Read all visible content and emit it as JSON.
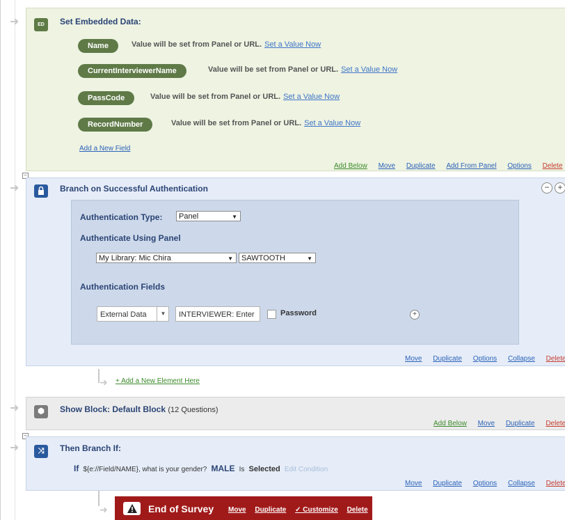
{
  "embedded": {
    "icon_label": "ED",
    "title": "Set Embedded Data:",
    "fields": [
      {
        "name": "Name",
        "info": "Value will be set from Panel or URL.",
        "link": "Set a Value Now"
      },
      {
        "name": "CurrentInterviewerName",
        "info": "Value will be set from Panel or URL.",
        "link": "Set a Value Now"
      },
      {
        "name": "PassCode",
        "info": "Value will be set from Panel or URL.",
        "link": "Set a Value Now"
      },
      {
        "name": "RecordNumber",
        "info": "Value will be set from Panel or URL.",
        "link": "Set a Value Now"
      }
    ],
    "add_field": "Add a New Field",
    "actions": {
      "add_below": "Add Below",
      "move": "Move",
      "duplicate": "Duplicate",
      "add_from_panel": "Add From Panel",
      "options": "Options",
      "delete": "Delete"
    }
  },
  "auth": {
    "title": "Branch on Successful Authentication",
    "type_label": "Authentication Type:",
    "type_value": "Panel",
    "using_label": "Authenticate Using Panel",
    "library_value": "My Library: Mic Chira",
    "panel_value": "SAWTOOTH",
    "fields_label": "Authentication Fields",
    "field_source": "External Data",
    "field_value": "INTERVIEWER: Enter",
    "password_label": "Password",
    "collapse_minus": "−",
    "collapse_plus": "+",
    "add_plus": "+",
    "actions": {
      "move": "Move",
      "duplicate": "Duplicate",
      "options": "Options",
      "collapse": "Collapse",
      "delete": "Delete"
    }
  },
  "add_element": "+ Add a New Element Here",
  "block": {
    "title": "Show Block: Default Block",
    "count": "(12 Questions)",
    "actions": {
      "add_below": "Add Below",
      "move": "Move",
      "duplicate": "Duplicate",
      "delete": "Delete"
    }
  },
  "branch": {
    "title": "Then Branch If:",
    "if": "If",
    "question": "${e://Field/NAME}, what is your gender?",
    "answer": "MALE",
    "is": "Is",
    "selected": "Selected",
    "edit": "Edit Condition",
    "actions": {
      "move": "Move",
      "duplicate": "Duplicate",
      "options": "Options",
      "collapse": "Collapse",
      "delete": "Delete"
    }
  },
  "end": {
    "title": "End of Survey",
    "actions": {
      "move": "Move",
      "duplicate": "Duplicate",
      "customize": "✓ Customize",
      "delete": "Delete"
    }
  }
}
